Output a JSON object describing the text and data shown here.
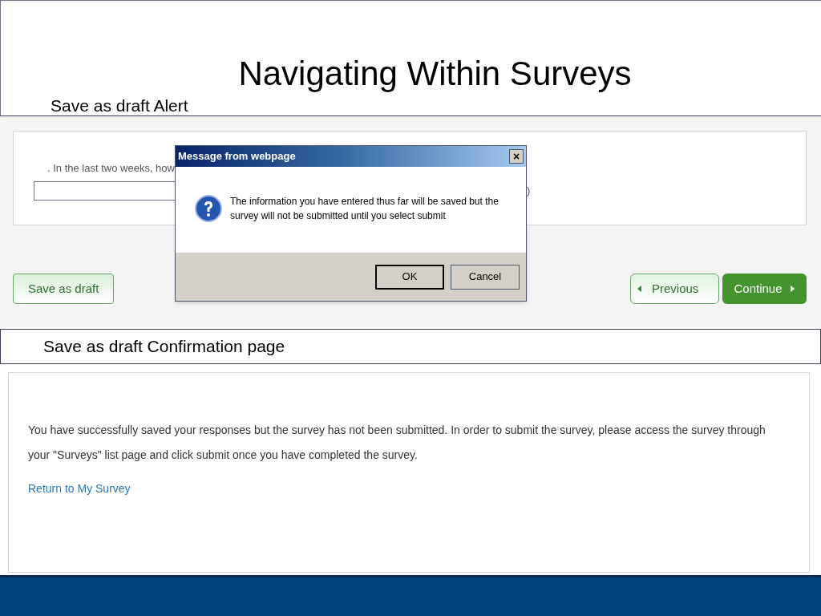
{
  "slide": {
    "title": "Navigating Within Surveys"
  },
  "alert_section": {
    "caption": "Save as draft Alert",
    "question": ". In the last two weeks, how",
    "partial_text": ")",
    "save_button": "Save as draft",
    "previous_button": "Previous",
    "continue_button": "Continue",
    "dialog": {
      "title": "Message from webpage",
      "close": "×",
      "message": "The information you have entered thus far will be saved but the survey will not be submitted until you select submit",
      "buttons": [
        {
          "label": "OK",
          "selected": true
        },
        {
          "label": "Cancel",
          "selected": false
        }
      ]
    }
  },
  "confirmation_section": {
    "caption": "Save as draft Confirmation page",
    "message": "You have successfully saved your responses but the survey has not been submitted. In order to submit the survey, please access the survey through your \"Surveys\" list page and click submit once you have completed the survey.",
    "link": "Return to My Survey"
  }
}
